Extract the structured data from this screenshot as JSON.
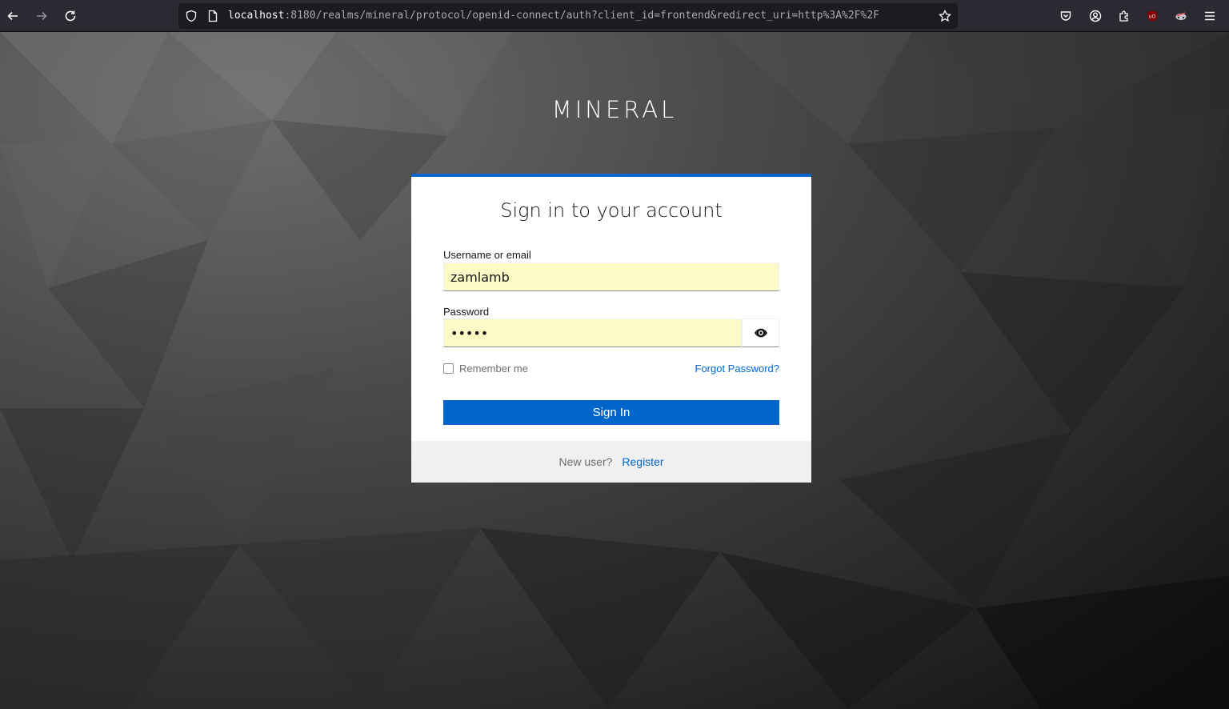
{
  "browser": {
    "url_host": "localhost",
    "url_rest": ":8180/realms/mineral/protocol/openid-connect/auth?client_id=frontend&redirect_uri=http%3A%2F%2F",
    "icons": {
      "back": "arrow-left-icon",
      "forward": "arrow-right-icon",
      "reload": "reload-icon",
      "shield": "shield-icon",
      "page": "page-icon",
      "bookmark": "star-icon",
      "pocket": "pocket-icon",
      "account": "account-icon",
      "extensions": "extensions-icon",
      "ublock": "ublock-icon",
      "extension2": "extension-icon",
      "menu": "hamburger-menu-icon"
    }
  },
  "page": {
    "brand": "MINERAL",
    "login": {
      "title": "Sign in to your account",
      "username_label": "Username or email",
      "username_value": "zamlamb",
      "password_label": "Password",
      "password_value": "•••••",
      "show_password_icon": "eye-icon",
      "remember_label": "Remember me",
      "remember_checked": false,
      "forgot_label": "Forgot Password?",
      "submit_label": "Sign In",
      "new_user_text": "New user?",
      "register_label": "Register"
    }
  },
  "colors": {
    "accent": "#0066cc",
    "autofill": "#fcfbc7",
    "toolbar": "#2b2a33"
  }
}
